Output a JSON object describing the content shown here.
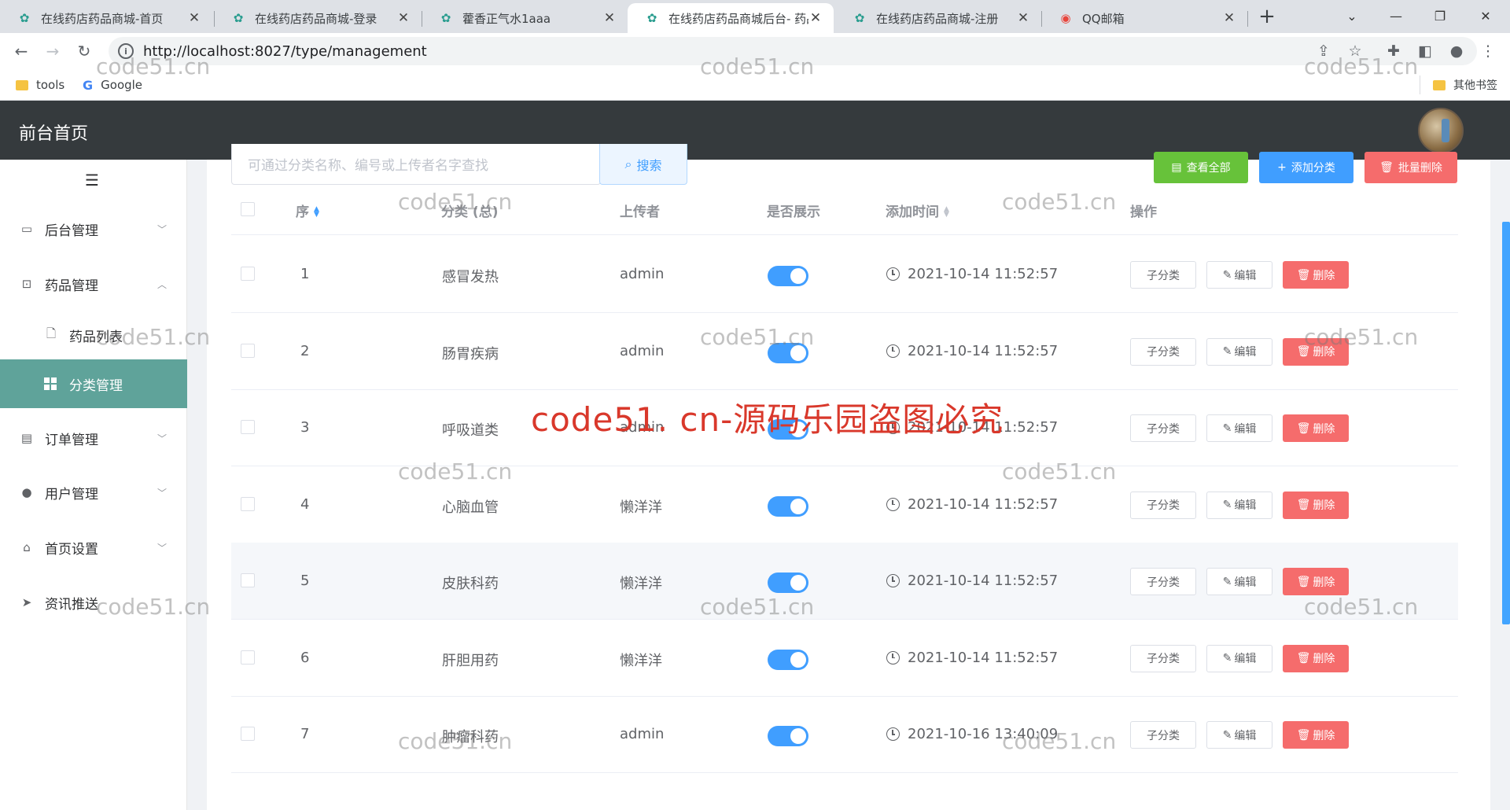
{
  "browser": {
    "tabs": [
      {
        "title": "在线药店药品商城-首页",
        "active": false
      },
      {
        "title": "在线药店药品商城-登录",
        "active": false
      },
      {
        "title": "藿香正气水1aaa",
        "active": false
      },
      {
        "title": "在线药店药品商城后台- 药品",
        "active": true
      },
      {
        "title": "在线药店药品商城-注册",
        "active": false
      },
      {
        "title": "QQ邮箱",
        "active": false
      }
    ],
    "new_tab": "+",
    "url": "http://localhost:8027/type/management",
    "bookmarks": [
      "tools",
      "Google"
    ],
    "other_bookmarks": "其他书签"
  },
  "header": {
    "title": "前台首页"
  },
  "sidebar": {
    "items": [
      {
        "label": "后台管理",
        "icon": "calendar-icon",
        "expanded": false
      },
      {
        "label": "药品管理",
        "icon": "medkit-icon",
        "expanded": true
      },
      {
        "label": "药品列表",
        "icon": "document-icon",
        "sub": true
      },
      {
        "label": "分类管理",
        "icon": "grid-icon",
        "sub": true,
        "active": true
      },
      {
        "label": "订单管理",
        "icon": "receipt-icon",
        "expanded": false
      },
      {
        "label": "用户管理",
        "icon": "user-icon",
        "expanded": false
      },
      {
        "label": "首页设置",
        "icon": "home-icon",
        "expanded": false
      },
      {
        "label": "资讯推送",
        "icon": "send-icon",
        "expanded": false
      }
    ]
  },
  "toolbar": {
    "search_placeholder": "可通过分类名称、编号或上传者名字查找",
    "search_label": "搜索",
    "view_all_label": "查看全部",
    "add_label": "添加分类",
    "batch_delete_label": "批量删除"
  },
  "table": {
    "headers": {
      "index": "序",
      "name": "分类 (总)",
      "uploader": "上传者",
      "show": "是否展示",
      "time": "添加时间",
      "ops": "操作"
    },
    "rows": [
      {
        "index": "1",
        "name": "感冒发热",
        "uploader": "admin",
        "show": true,
        "time": "2021-10-14 11:52:57"
      },
      {
        "index": "2",
        "name": "肠胃疾病",
        "uploader": "admin",
        "show": true,
        "time": "2021-10-14 11:52:57"
      },
      {
        "index": "3",
        "name": "呼吸道类",
        "uploader": "admin",
        "show": true,
        "time": "2021-10-14 11:52:57"
      },
      {
        "index": "4",
        "name": "心脑血管",
        "uploader": "懒洋洋",
        "show": true,
        "time": "2021-10-14 11:52:57"
      },
      {
        "index": "5",
        "name": "皮肤科药",
        "uploader": "懒洋洋",
        "show": true,
        "time": "2021-10-14 11:52:57"
      },
      {
        "index": "6",
        "name": "肝胆用药",
        "uploader": "懒洋洋",
        "show": true,
        "time": "2021-10-14 11:52:57"
      },
      {
        "index": "7",
        "name": "肿瘤科药",
        "uploader": "admin",
        "show": true,
        "time": "2021-10-16 13:40:09"
      }
    ],
    "op_sub_label": "子分类",
    "op_edit_label": "编辑",
    "op_delete_label": "删除"
  },
  "watermark": {
    "small": "code51.cn",
    "big": "code51. cn-源码乐园盗图必究"
  },
  "colors": {
    "header_bg": "#353a3d",
    "active_menu": "#5fa39a",
    "switch_on": "#409eff",
    "danger": "#f56c6c",
    "success": "#67c23a",
    "primary": "#409eff"
  }
}
